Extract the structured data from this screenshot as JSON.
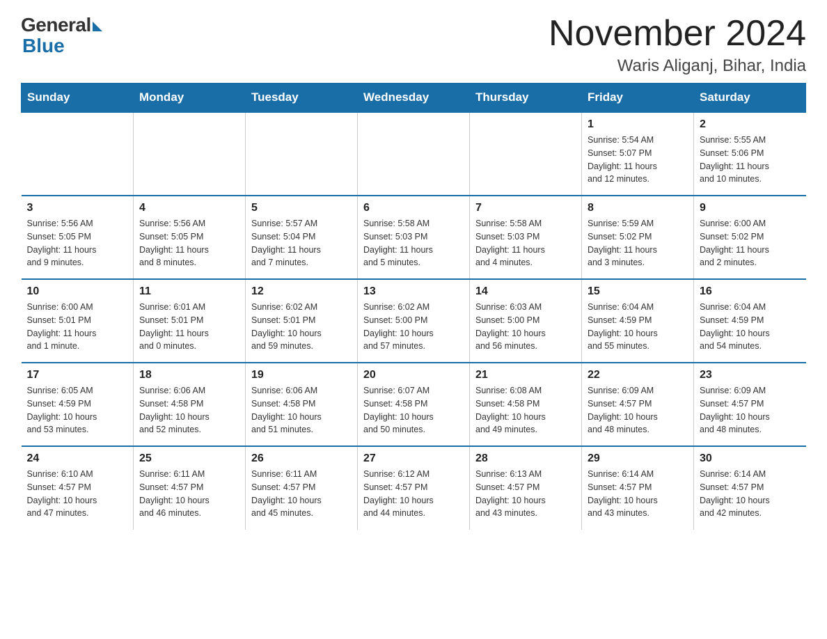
{
  "logo": {
    "general": "General",
    "blue": "Blue"
  },
  "title": "November 2024",
  "subtitle": "Waris Aliganj, Bihar, India",
  "days_of_week": [
    "Sunday",
    "Monday",
    "Tuesday",
    "Wednesday",
    "Thursday",
    "Friday",
    "Saturday"
  ],
  "weeks": [
    [
      {
        "day": "",
        "info": ""
      },
      {
        "day": "",
        "info": ""
      },
      {
        "day": "",
        "info": ""
      },
      {
        "day": "",
        "info": ""
      },
      {
        "day": "",
        "info": ""
      },
      {
        "day": "1",
        "info": "Sunrise: 5:54 AM\nSunset: 5:07 PM\nDaylight: 11 hours\nand 12 minutes."
      },
      {
        "day": "2",
        "info": "Sunrise: 5:55 AM\nSunset: 5:06 PM\nDaylight: 11 hours\nand 10 minutes."
      }
    ],
    [
      {
        "day": "3",
        "info": "Sunrise: 5:56 AM\nSunset: 5:05 PM\nDaylight: 11 hours\nand 9 minutes."
      },
      {
        "day": "4",
        "info": "Sunrise: 5:56 AM\nSunset: 5:05 PM\nDaylight: 11 hours\nand 8 minutes."
      },
      {
        "day": "5",
        "info": "Sunrise: 5:57 AM\nSunset: 5:04 PM\nDaylight: 11 hours\nand 7 minutes."
      },
      {
        "day": "6",
        "info": "Sunrise: 5:58 AM\nSunset: 5:03 PM\nDaylight: 11 hours\nand 5 minutes."
      },
      {
        "day": "7",
        "info": "Sunrise: 5:58 AM\nSunset: 5:03 PM\nDaylight: 11 hours\nand 4 minutes."
      },
      {
        "day": "8",
        "info": "Sunrise: 5:59 AM\nSunset: 5:02 PM\nDaylight: 11 hours\nand 3 minutes."
      },
      {
        "day": "9",
        "info": "Sunrise: 6:00 AM\nSunset: 5:02 PM\nDaylight: 11 hours\nand 2 minutes."
      }
    ],
    [
      {
        "day": "10",
        "info": "Sunrise: 6:00 AM\nSunset: 5:01 PM\nDaylight: 11 hours\nand 1 minute."
      },
      {
        "day": "11",
        "info": "Sunrise: 6:01 AM\nSunset: 5:01 PM\nDaylight: 11 hours\nand 0 minutes."
      },
      {
        "day": "12",
        "info": "Sunrise: 6:02 AM\nSunset: 5:01 PM\nDaylight: 10 hours\nand 59 minutes."
      },
      {
        "day": "13",
        "info": "Sunrise: 6:02 AM\nSunset: 5:00 PM\nDaylight: 10 hours\nand 57 minutes."
      },
      {
        "day": "14",
        "info": "Sunrise: 6:03 AM\nSunset: 5:00 PM\nDaylight: 10 hours\nand 56 minutes."
      },
      {
        "day": "15",
        "info": "Sunrise: 6:04 AM\nSunset: 4:59 PM\nDaylight: 10 hours\nand 55 minutes."
      },
      {
        "day": "16",
        "info": "Sunrise: 6:04 AM\nSunset: 4:59 PM\nDaylight: 10 hours\nand 54 minutes."
      }
    ],
    [
      {
        "day": "17",
        "info": "Sunrise: 6:05 AM\nSunset: 4:59 PM\nDaylight: 10 hours\nand 53 minutes."
      },
      {
        "day": "18",
        "info": "Sunrise: 6:06 AM\nSunset: 4:58 PM\nDaylight: 10 hours\nand 52 minutes."
      },
      {
        "day": "19",
        "info": "Sunrise: 6:06 AM\nSunset: 4:58 PM\nDaylight: 10 hours\nand 51 minutes."
      },
      {
        "day": "20",
        "info": "Sunrise: 6:07 AM\nSunset: 4:58 PM\nDaylight: 10 hours\nand 50 minutes."
      },
      {
        "day": "21",
        "info": "Sunrise: 6:08 AM\nSunset: 4:58 PM\nDaylight: 10 hours\nand 49 minutes."
      },
      {
        "day": "22",
        "info": "Sunrise: 6:09 AM\nSunset: 4:57 PM\nDaylight: 10 hours\nand 48 minutes."
      },
      {
        "day": "23",
        "info": "Sunrise: 6:09 AM\nSunset: 4:57 PM\nDaylight: 10 hours\nand 48 minutes."
      }
    ],
    [
      {
        "day": "24",
        "info": "Sunrise: 6:10 AM\nSunset: 4:57 PM\nDaylight: 10 hours\nand 47 minutes."
      },
      {
        "day": "25",
        "info": "Sunrise: 6:11 AM\nSunset: 4:57 PM\nDaylight: 10 hours\nand 46 minutes."
      },
      {
        "day": "26",
        "info": "Sunrise: 6:11 AM\nSunset: 4:57 PM\nDaylight: 10 hours\nand 45 minutes."
      },
      {
        "day": "27",
        "info": "Sunrise: 6:12 AM\nSunset: 4:57 PM\nDaylight: 10 hours\nand 44 minutes."
      },
      {
        "day": "28",
        "info": "Sunrise: 6:13 AM\nSunset: 4:57 PM\nDaylight: 10 hours\nand 43 minutes."
      },
      {
        "day": "29",
        "info": "Sunrise: 6:14 AM\nSunset: 4:57 PM\nDaylight: 10 hours\nand 43 minutes."
      },
      {
        "day": "30",
        "info": "Sunrise: 6:14 AM\nSunset: 4:57 PM\nDaylight: 10 hours\nand 42 minutes."
      }
    ]
  ],
  "colors": {
    "header_bg": "#1a6ea8",
    "header_text": "#ffffff",
    "border": "#1a6ea8"
  }
}
